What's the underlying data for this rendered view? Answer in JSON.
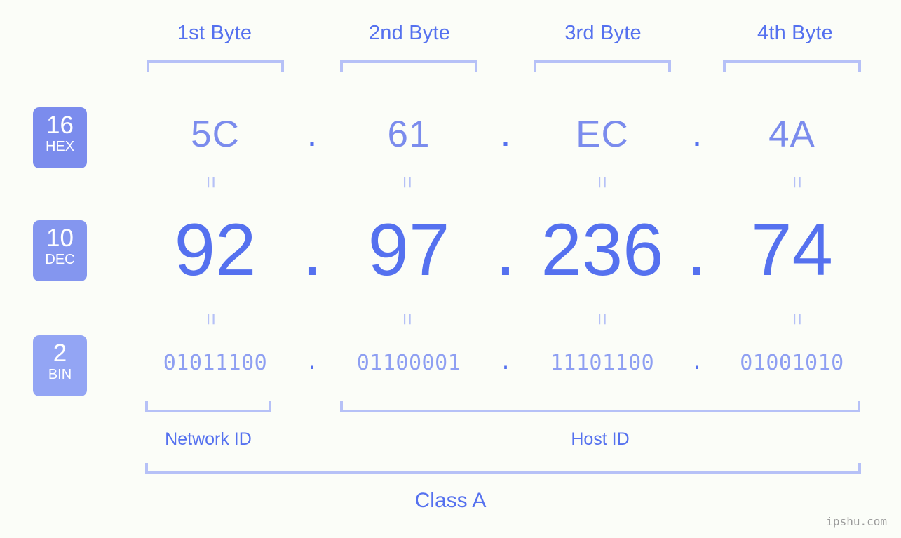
{
  "background": "#fbfdf8",
  "colors": {
    "accent_strong": "#5571ef",
    "accent_medium": "#7b8ced",
    "accent_light": "#8e9ff2",
    "bracket": "#b6c1f7",
    "badge_hex": "#7b8ced",
    "badge_dec": "#8496ef",
    "badge_bin": "#93a5f4",
    "watermark": "#9a9a9a"
  },
  "byte_headers": [
    {
      "label": "1st Byte"
    },
    {
      "label": "2nd Byte"
    },
    {
      "label": "3rd Byte"
    },
    {
      "label": "4th Byte"
    }
  ],
  "bases": [
    {
      "id": "hex",
      "number": "16",
      "name": "HEX"
    },
    {
      "id": "dec",
      "number": "10",
      "name": "DEC"
    },
    {
      "id": "bin",
      "number": "2",
      "name": "BIN"
    }
  ],
  "separator": ".",
  "equals_glyph": "=",
  "rows": {
    "hex": {
      "values": [
        "5C",
        "61",
        "EC",
        "4A"
      ]
    },
    "dec": {
      "values": [
        "92",
        "97",
        "236",
        "74"
      ]
    },
    "bin": {
      "values": [
        "01011100",
        "01100001",
        "11101100",
        "01001010"
      ]
    }
  },
  "segments": {
    "network_id": "Network ID",
    "host_id": "Host ID",
    "class": "Class A"
  },
  "watermark": "ipshu.com",
  "chart_data": {
    "type": "table",
    "title": "IP address byte breakdown",
    "categories": [
      "1st Byte",
      "2nd Byte",
      "3rd Byte",
      "4th Byte"
    ],
    "series": [
      {
        "name": "HEX (base 16)",
        "values": [
          "5C",
          "61",
          "EC",
          "4A"
        ]
      },
      {
        "name": "DEC (base 10)",
        "values": [
          "92",
          "97",
          "236",
          "74"
        ]
      },
      {
        "name": "BIN (base 2)",
        "values": [
          "01011100",
          "01100001",
          "11101100",
          "01001010"
        ]
      }
    ],
    "annotations": {
      "network_id_bytes": [
        "1st Byte"
      ],
      "host_id_bytes": [
        "2nd Byte",
        "3rd Byte",
        "4th Byte"
      ],
      "class": "Class A",
      "dotted_decimal": "92.97.236.74"
    }
  }
}
